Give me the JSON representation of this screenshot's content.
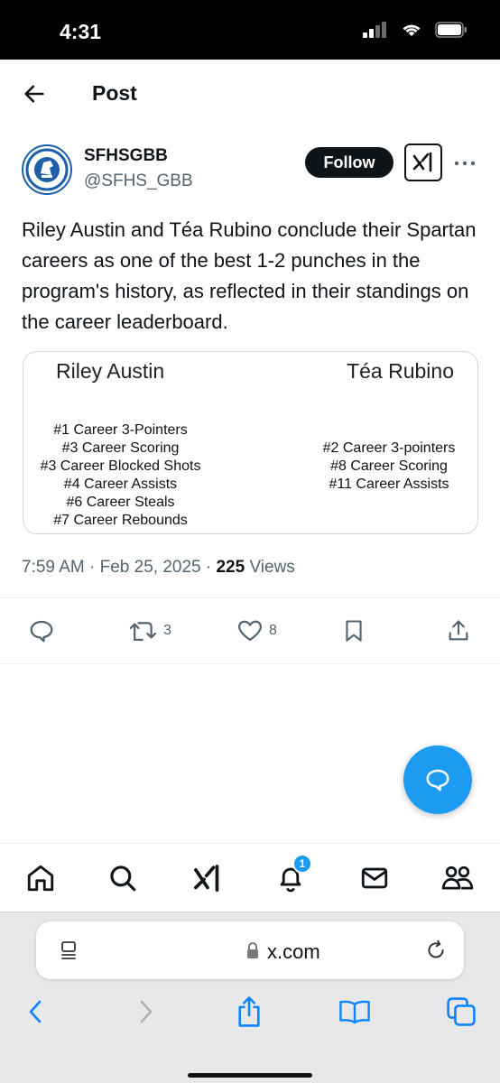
{
  "status_bar": {
    "time": "4:31"
  },
  "header": {
    "title": "Post"
  },
  "author": {
    "display_name": "SFHSGBB",
    "handle": "@SFHS_GBB",
    "follow_label": "Follow"
  },
  "post": {
    "text": "Riley Austin and Téa Rubino conclude their Spartan careers as one of the best 1-2 punches in the program's history, as reflected in their standings on the career leaderboard.",
    "media": {
      "left": {
        "name": "Riley Austin",
        "stats": [
          "#1 Career 3-Pointers",
          "#3 Career Scoring",
          "#3 Career Blocked Shots",
          "#4 Career Assists",
          "#6 Career Steals",
          "#7 Career Rebounds"
        ]
      },
      "right": {
        "name": "Téa Rubino",
        "stats": [
          "#2 Career 3-pointers",
          "#8 Career Scoring",
          "#11 Career Assists"
        ]
      }
    },
    "time": "7:59 AM",
    "date": "Feb 25, 2025",
    "views_count": "225",
    "views_label": "Views"
  },
  "actions": {
    "reposts": "3",
    "likes": "8"
  },
  "notifications_badge": "1",
  "browser": {
    "url": "x.com"
  },
  "colors": {
    "accent": "#1d9bf0",
    "text": "#0f1419",
    "muted": "#536471",
    "ios_blue": "#0a84ff"
  }
}
